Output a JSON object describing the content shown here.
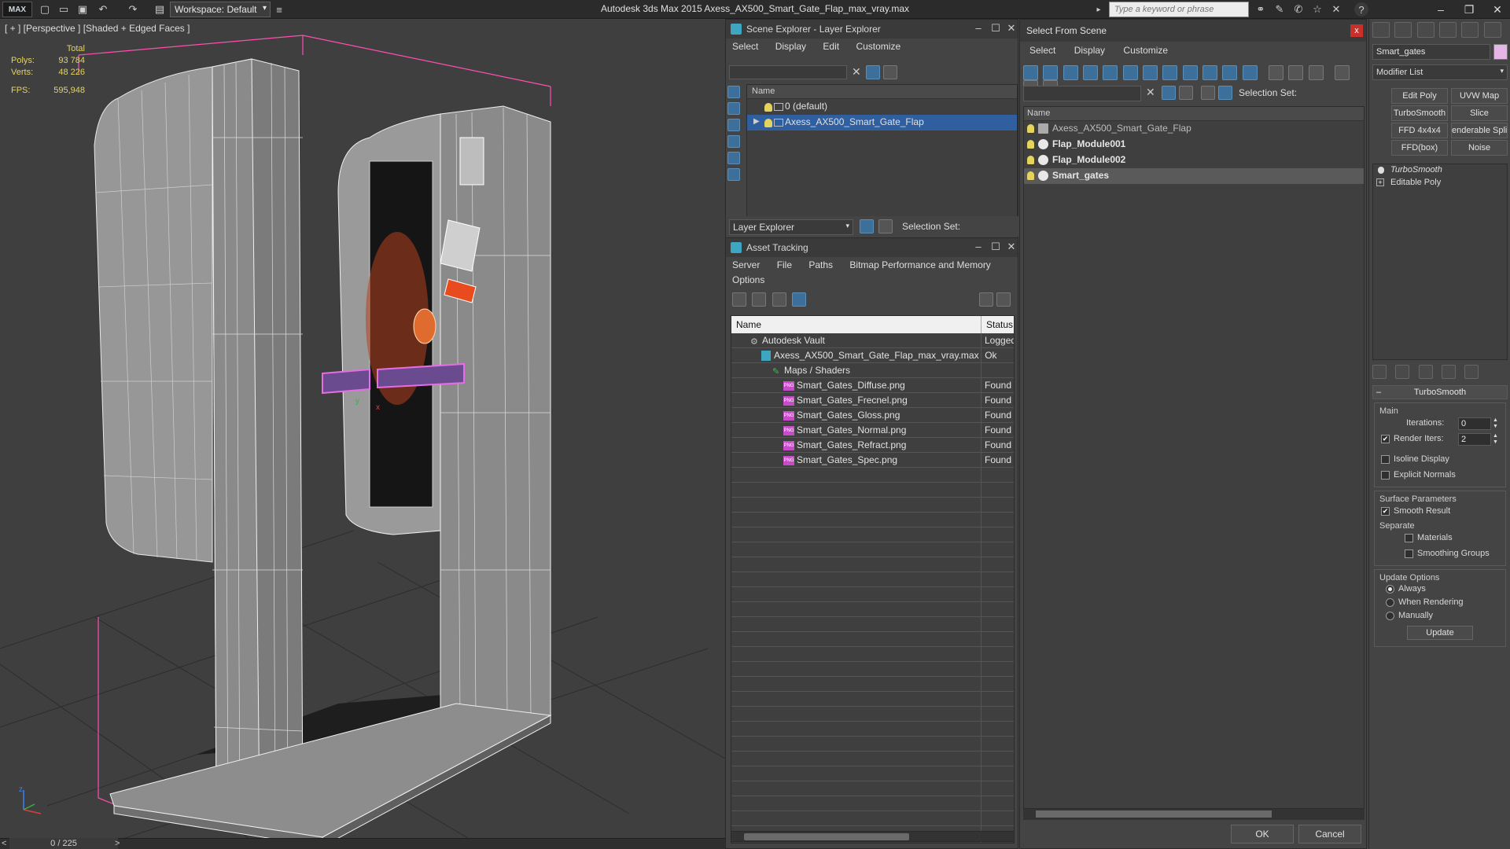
{
  "app": {
    "logo_text": "MAX",
    "workspace": "Workspace: Default",
    "title": "Autodesk 3ds Max  2015     Axess_AX500_Smart_Gate_Flap_max_vray.max",
    "search_placeholder": "Type a keyword or phrase"
  },
  "viewport": {
    "label": "[ + ] [Perspective ] [Shaded + Edged Faces ]",
    "stats": {
      "total_label": "Total",
      "polys_label": "Polys:",
      "polys_value": "93 784",
      "verts_label": "Verts:",
      "verts_value": "48 226",
      "fps_label": "FPS:",
      "fps_value": "595,948"
    },
    "axis_labels": {
      "x": "x",
      "y": "y",
      "z": "z"
    }
  },
  "time_slider": {
    "value": "0 / 225",
    "prev": "<",
    "next": ">"
  },
  "scene_explorer": {
    "title": "Scene Explorer - Layer Explorer",
    "menu": [
      "Select",
      "Display",
      "Edit",
      "Customize"
    ],
    "column_name": "Name",
    "layers": [
      {
        "name": "0 (default)",
        "selected": false
      },
      {
        "name": "Axess_AX500_Smart_Gate_Flap",
        "selected": true
      }
    ],
    "footer_dropdown": "Layer Explorer",
    "selection_set_label": "Selection Set:"
  },
  "asset_tracking": {
    "title": "Asset Tracking",
    "menu_row1": [
      "Server",
      "File",
      "Paths",
      "Bitmap Performance and Memory"
    ],
    "menu_row2": [
      "Options"
    ],
    "columns": [
      "Name",
      "Status"
    ],
    "rows": [
      {
        "name": "Autodesk Vault",
        "status": "Logged",
        "indent": 1,
        "icon": "vault"
      },
      {
        "name": "Axess_AX500_Smart_Gate_Flap_max_vray.max",
        "status": "Ok",
        "indent": 2,
        "icon": "file"
      },
      {
        "name": "Maps / Shaders",
        "status": "",
        "indent": 3,
        "icon": "folder"
      },
      {
        "name": "Smart_Gates_Diffuse.png",
        "status": "Found",
        "indent": 4,
        "icon": "png"
      },
      {
        "name": "Smart_Gates_Frecnel.png",
        "status": "Found",
        "indent": 4,
        "icon": "png"
      },
      {
        "name": "Smart_Gates_Gloss.png",
        "status": "Found",
        "indent": 4,
        "icon": "png"
      },
      {
        "name": "Smart_Gates_Normal.png",
        "status": "Found",
        "indent": 4,
        "icon": "png"
      },
      {
        "name": "Smart_Gates_Refract.png",
        "status": "Found",
        "indent": 4,
        "icon": "png"
      },
      {
        "name": "Smart_Gates_Spec.png",
        "status": "Found",
        "indent": 4,
        "icon": "png"
      }
    ],
    "png_icon_text": "PNG"
  },
  "select_from_scene": {
    "title": "Select From Scene",
    "close_label": "x",
    "menu": [
      "Select",
      "Display",
      "Customize"
    ],
    "selection_set_label": "Selection Set:",
    "column_name": "Name",
    "objects": [
      {
        "name": "Axess_AX500_Smart_Gate_Flap",
        "bold": false,
        "group": true,
        "highlight": false
      },
      {
        "name": "Flap_Module001",
        "bold": true,
        "group": false,
        "highlight": false
      },
      {
        "name": "Flap_Module002",
        "bold": true,
        "group": false,
        "highlight": false
      },
      {
        "name": "Smart_gates",
        "bold": true,
        "group": false,
        "highlight": true
      }
    ],
    "ok_label": "OK",
    "cancel_label": "Cancel"
  },
  "command_panel": {
    "object_name": "Smart_gates",
    "modifier_list": "Modifier List",
    "modifier_buttons": [
      "Edit Poly",
      "UVW Map",
      "TurboSmooth",
      "Slice",
      "FFD 4x4x4",
      "enderable Splin",
      "FFD(box)",
      "Noise"
    ],
    "stack": [
      "TurboSmooth",
      "Editable Poly"
    ],
    "rollout_title": "TurboSmooth",
    "main_label": "Main",
    "iterations_label": "Iterations:",
    "iterations_value": "0",
    "render_iters_label": "Render Iters:",
    "render_iters_value": "2",
    "isoline_label": "Isoline Display",
    "explicit_normals_label": "Explicit Normals",
    "surface_params_label": "Surface Parameters",
    "smooth_result_label": "Smooth Result",
    "separate_label": "Separate",
    "materials_label": "Materials",
    "smoothing_groups_label": "Smoothing Groups",
    "update_options_label": "Update Options",
    "always_label": "Always",
    "when_rendering_label": "When Rendering",
    "manually_label": "Manually",
    "update_button": "Update"
  },
  "colors": {
    "selection_blue": "#2f5f9e",
    "stats_yellow": "#e0d36a",
    "wire_white": "#e8e8e8",
    "bbox_pink": "#ff4fb0",
    "close_red": "#c9302c"
  }
}
